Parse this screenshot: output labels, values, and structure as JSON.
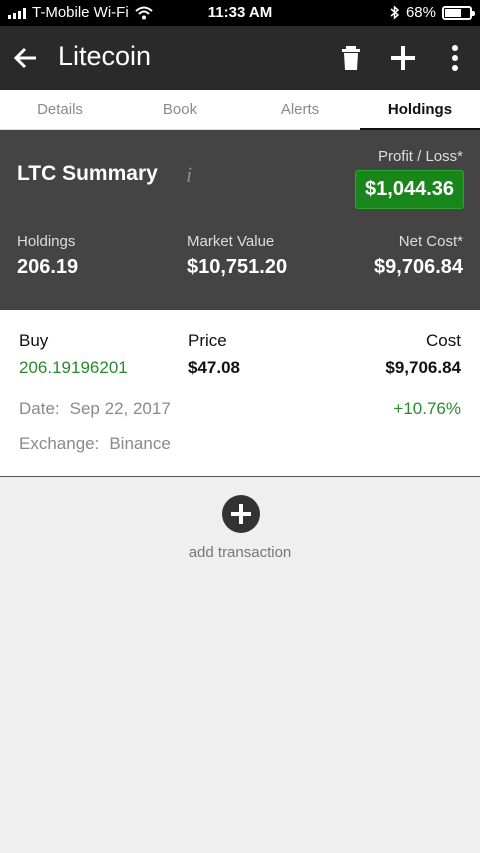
{
  "status_bar": {
    "carrier": "T-Mobile Wi-Fi",
    "time": "11:33 AM",
    "battery": "68%",
    "battery_level": 0.68
  },
  "appbar": {
    "title": "Litecoin",
    "icons": [
      "back-arrow-icon",
      "trash-icon",
      "plus-icon",
      "more-vertical-icon"
    ]
  },
  "tabs": [
    {
      "label": "Details",
      "active": false
    },
    {
      "label": "Book",
      "active": false
    },
    {
      "label": "Alerts",
      "active": false
    },
    {
      "label": "Holdings",
      "active": true
    }
  ],
  "summary": {
    "title": "LTC Summary",
    "info_icon": "i",
    "profit_loss_label": "Profit / Loss*",
    "profit_loss_value": "$1,044.36",
    "holdings_label": "Holdings",
    "holdings_value": "206.19",
    "market_value_label": "Market Value",
    "market_value_value": "$10,751.20",
    "net_cost_label": "Net Cost*",
    "net_cost_value": "$9,706.84"
  },
  "transaction": {
    "type_label": "Buy",
    "amount": "206.19196201",
    "price_label": "Price",
    "price_value": "$47.08",
    "cost_label": "Cost",
    "cost_value": "$9,706.84",
    "date_label": "Date:",
    "date_value": "Sep 22, 2017",
    "change": "+10.76%",
    "exchange_label": "Exchange:",
    "exchange_value": "Binance"
  },
  "add_transaction": {
    "label": "add transaction"
  },
  "colors": {
    "accent_green": "#18861b",
    "gain_text": "#2a8a2a",
    "appbar_bg": "#2a2a2a",
    "summary_bg": "#444444"
  }
}
